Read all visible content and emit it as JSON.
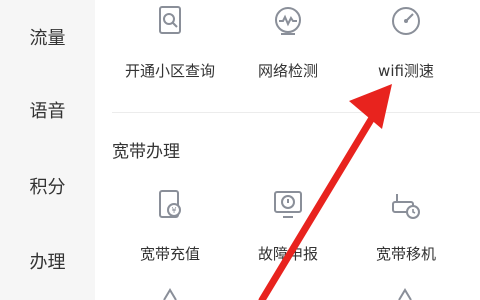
{
  "sidebar": {
    "items": [
      {
        "label": "流量"
      },
      {
        "label": "语音"
      },
      {
        "label": "积分"
      },
      {
        "label": "办理"
      }
    ]
  },
  "row1": {
    "items": [
      {
        "label": "开通小区查询",
        "icon": "community-search-icon"
      },
      {
        "label": "网络检测",
        "icon": "network-check-icon"
      },
      {
        "label": "wifi测速",
        "icon": "wifi-speed-icon"
      }
    ]
  },
  "broadband": {
    "title": "宽带办理",
    "items": [
      {
        "label": "宽带充值",
        "icon": "broadband-recharge-icon"
      },
      {
        "label": "故障申报",
        "icon": "fault-report-icon"
      },
      {
        "label": "宽带移机",
        "icon": "broadband-relocate-icon"
      }
    ]
  },
  "annotation": {
    "arrow_color": "#e8231e"
  },
  "colors": {
    "icon_gray": "#8a8f99",
    "sidebar_bg": "#f6f6f6"
  }
}
